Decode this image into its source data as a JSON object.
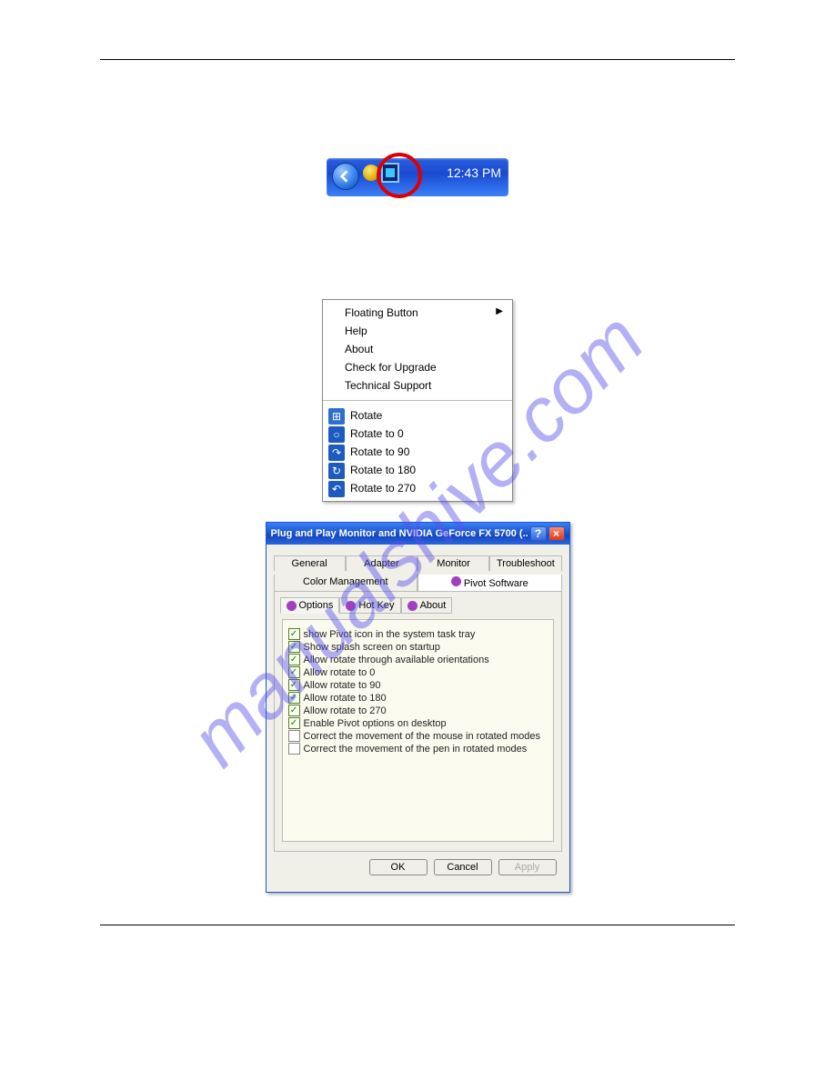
{
  "tray": {
    "time": "12:43 PM"
  },
  "menu": {
    "group1": [
      {
        "label": "Floating Button",
        "sub": true
      },
      {
        "label": "Help"
      },
      {
        "label": "About"
      },
      {
        "label": "Check for Upgrade"
      },
      {
        "label": "Technical Support"
      }
    ],
    "group2": [
      {
        "label": "Rotate",
        "icon": "rotate"
      },
      {
        "label": "Rotate to 0",
        "icon": "r0"
      },
      {
        "label": "Rotate to 90",
        "icon": "r90"
      },
      {
        "label": "Rotate to 180",
        "icon": "r180"
      },
      {
        "label": "Rotate to 270",
        "icon": "r270"
      }
    ]
  },
  "dialog": {
    "title": "Plug and Play Monitor and NVIDIA GeForce FX 5700 (...",
    "tabs_row1": [
      "General",
      "Adapter",
      "Monitor",
      "Troubleshoot"
    ],
    "tabs_row2": [
      "Color Management",
      "Pivot Software"
    ],
    "inner_tabs": [
      "Options",
      "Hot Key",
      "About"
    ],
    "options": [
      {
        "checked": true,
        "label": "show Pivot icon in the system task tray"
      },
      {
        "checked": true,
        "label": "Show splash screen on startup"
      },
      {
        "checked": true,
        "label": "Allow rotate through available orientations"
      },
      {
        "checked": true,
        "label": "Allow rotate to 0"
      },
      {
        "checked": true,
        "label": "Allow rotate to 90"
      },
      {
        "checked": true,
        "label": "Allow rotate to 180"
      },
      {
        "checked": true,
        "label": "Allow rotate to 270"
      },
      {
        "checked": true,
        "label": "Enable Pivot options on desktop"
      },
      {
        "checked": false,
        "label": "Correct the movement of the mouse in rotated modes"
      },
      {
        "checked": false,
        "label": "Correct the movement of the pen in rotated modes"
      }
    ],
    "buttons": {
      "ok": "OK",
      "cancel": "Cancel",
      "apply": "Apply"
    }
  },
  "watermark": "manualshive.com"
}
